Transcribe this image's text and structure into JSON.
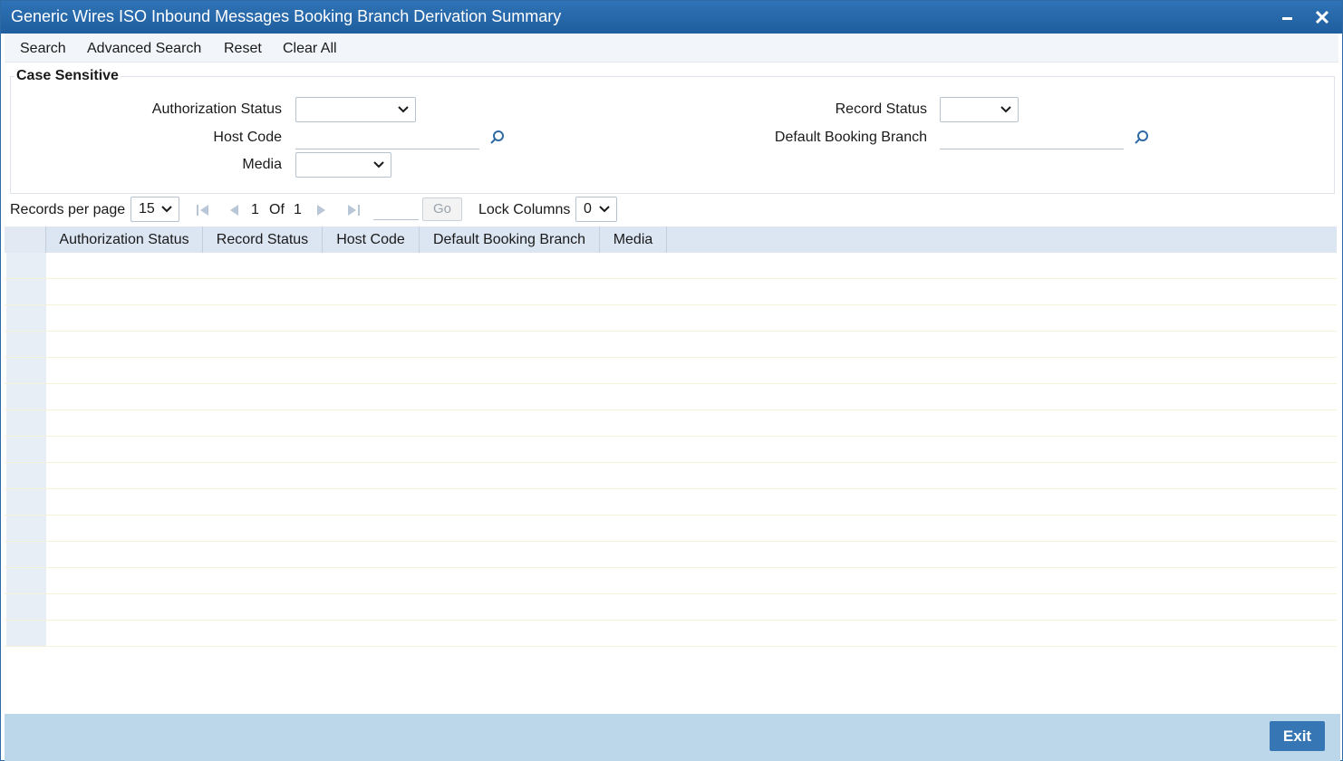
{
  "window": {
    "title": "Generic Wires ISO Inbound Messages Booking Branch Derivation Summary"
  },
  "toolbar": {
    "search": "Search",
    "advanced_search": "Advanced Search",
    "reset": "Reset",
    "clear_all": "Clear All"
  },
  "criteria": {
    "legend": "Case Sensitive",
    "authorization_status_label": "Authorization Status",
    "authorization_status_value": "",
    "record_status_label": "Record Status",
    "record_status_value": "",
    "host_code_label": "Host Code",
    "host_code_value": "",
    "default_booking_branch_label": "Default Booking Branch",
    "default_booking_branch_value": "",
    "media_label": "Media",
    "media_value": ""
  },
  "pager": {
    "records_per_page_label": "Records per page",
    "records_per_page_value": "15",
    "current_page": "1",
    "of_label": "Of",
    "total_pages": "1",
    "go_label": "Go",
    "go_page_value": "",
    "lock_columns_label": "Lock Columns",
    "lock_columns_value": "0"
  },
  "grid": {
    "columns": [
      "Authorization Status",
      "Record Status",
      "Host Code",
      "Default Booking Branch",
      "Media"
    ],
    "rows": [
      {},
      {},
      {},
      {},
      {},
      {},
      {},
      {},
      {},
      {},
      {},
      {},
      {},
      {},
      {}
    ]
  },
  "footer": {
    "exit_label": "Exit"
  },
  "colors": {
    "titlebar": "#2f73b6",
    "footer": "#bcd6ea",
    "exit_button": "#3776b4",
    "grid_header": "#dce6f3"
  }
}
